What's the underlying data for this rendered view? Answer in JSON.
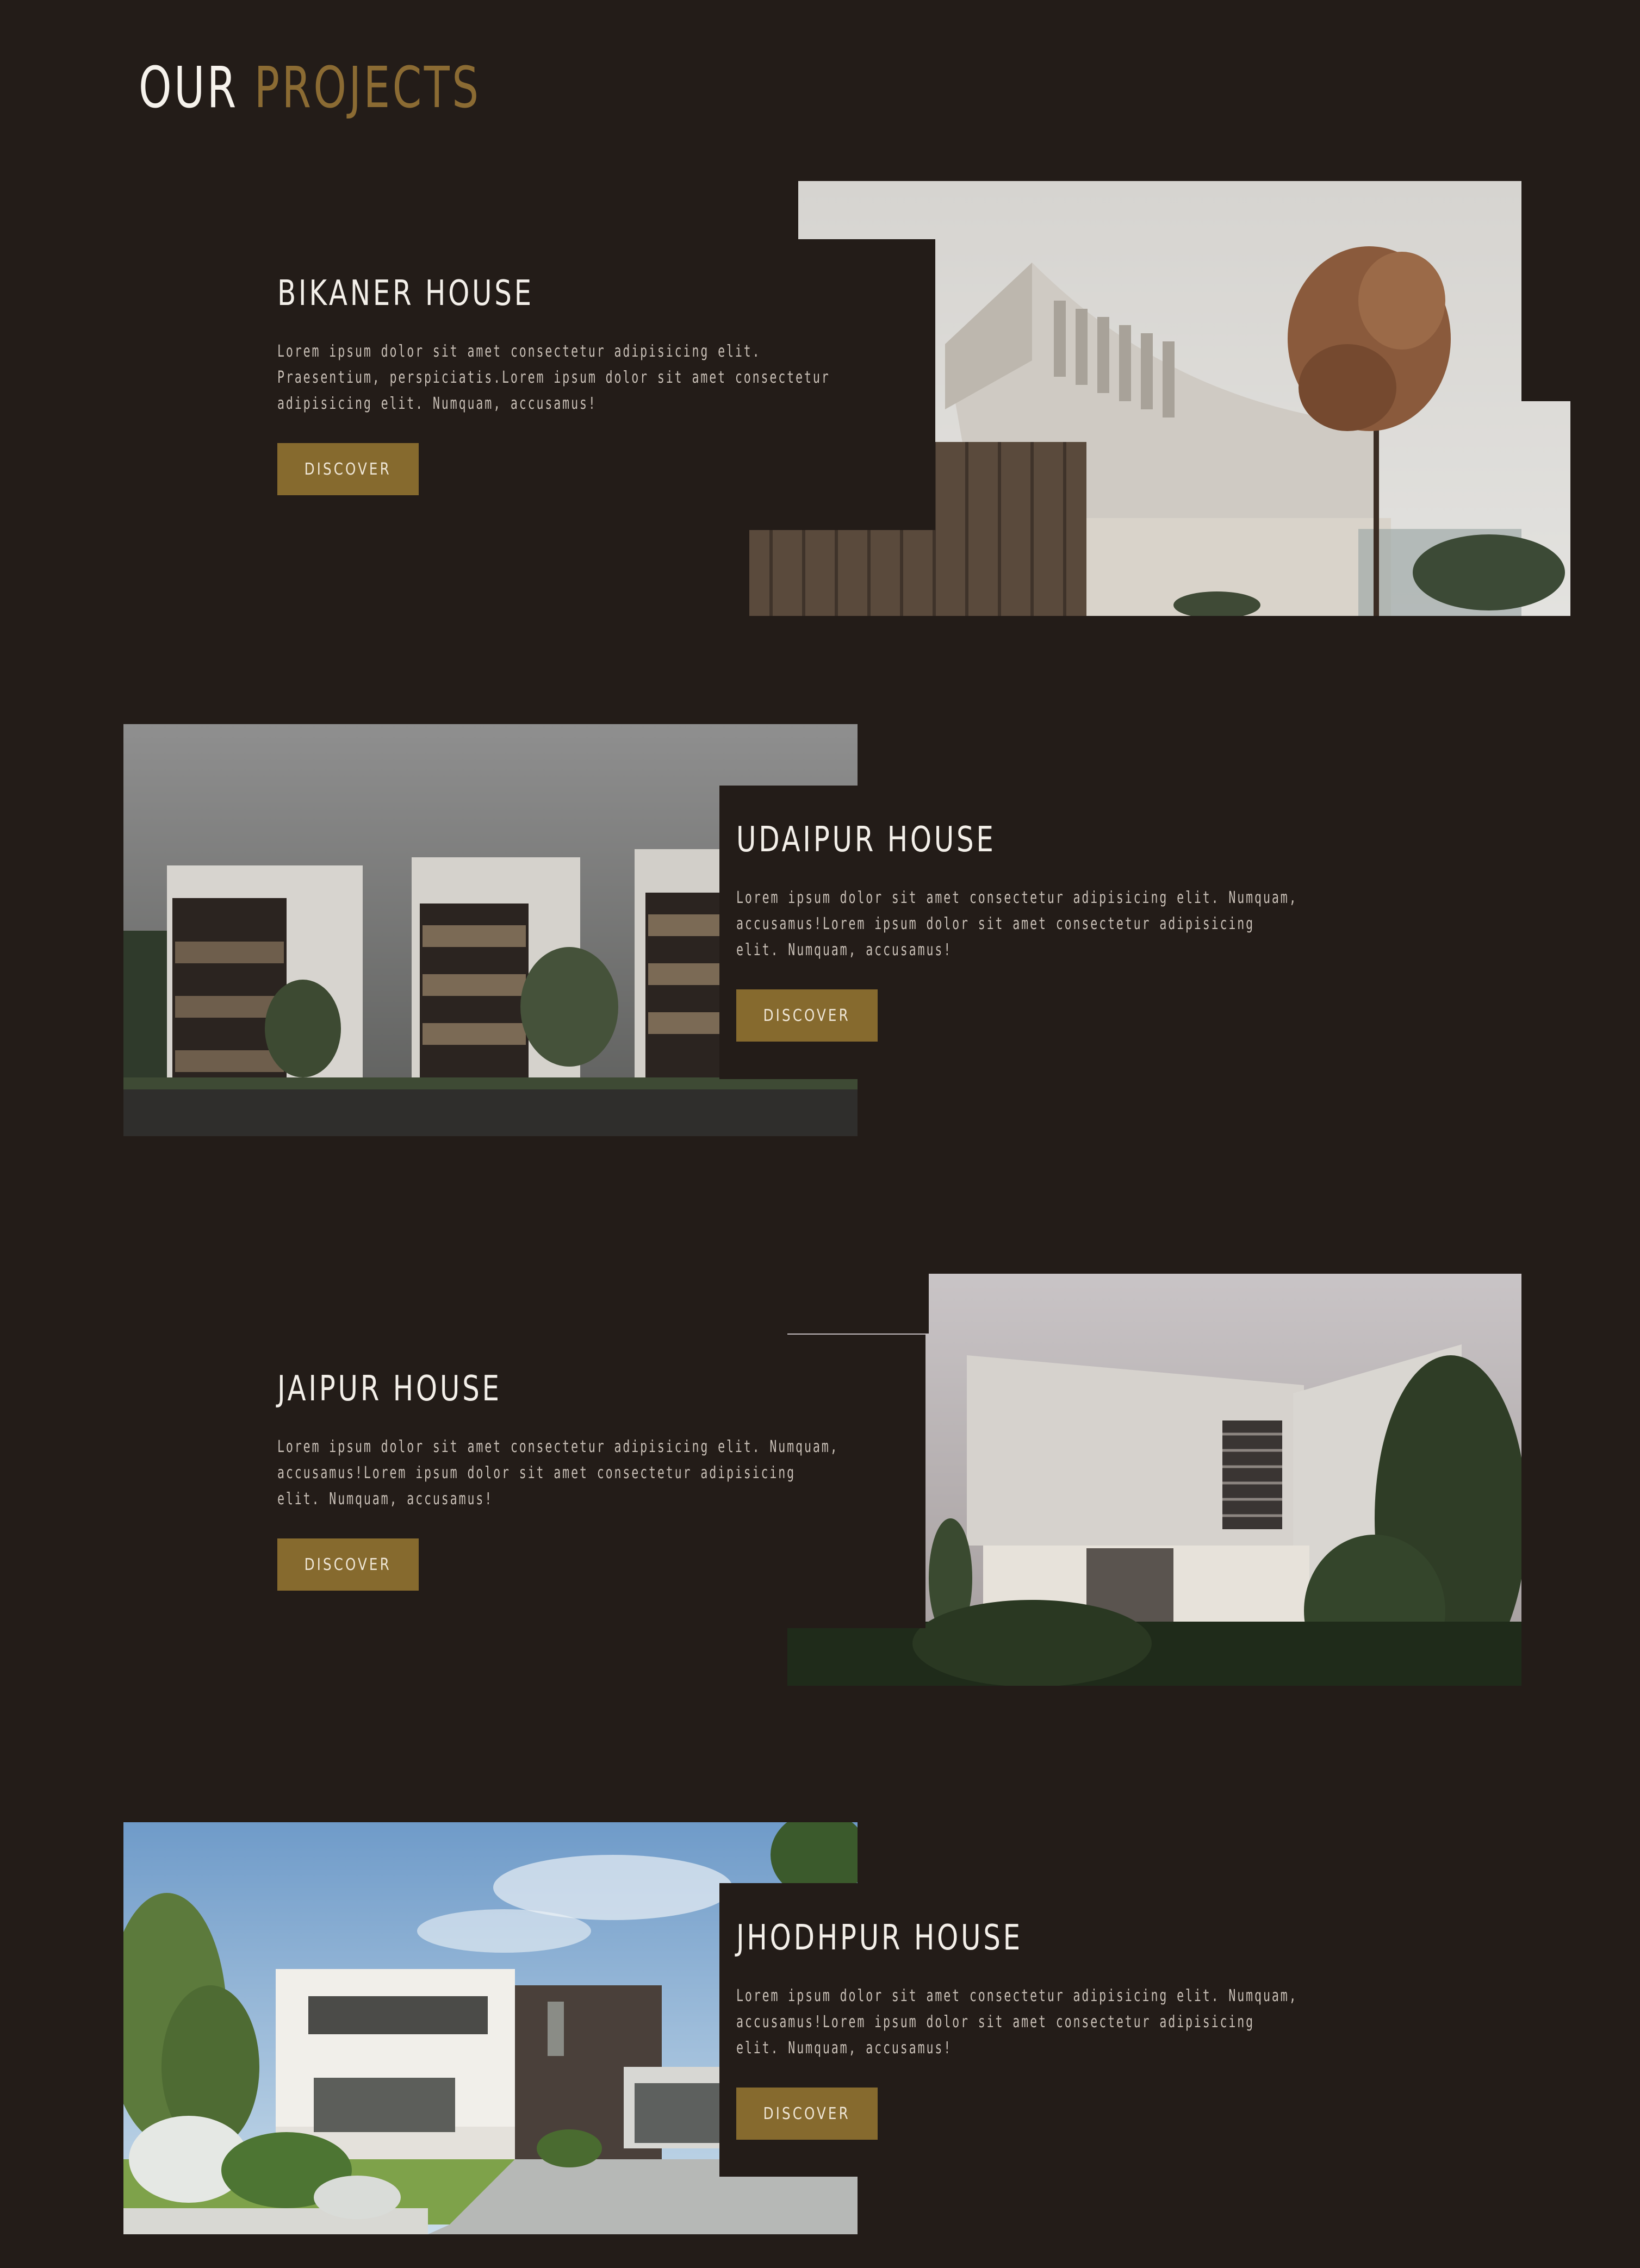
{
  "heading": {
    "word1": "OUR",
    "word2": "PROJECTS"
  },
  "colors": {
    "background": "#231c18",
    "accent_gold": "#866a2e",
    "heading_gold": "#8b6b33",
    "text_light": "#f3efe9",
    "text_muted": "#c8bfb6"
  },
  "projects": [
    {
      "title": "BIKANER HOUSE",
      "description": "Lorem ipsum dolor sit amet consectetur adipisicing elit. Praesentium, perspiciatis.Lorem ipsum dolor sit amet consectetur adipisicing elit. Numquam, accusamus!",
      "button": "DISCOVER",
      "image": "curved white brick house with tree"
    },
    {
      "title": "UDAIPUR HOUSE",
      "description": "Lorem ipsum dolor sit amet consectetur adipisicing elit. Numquam, accusamus!Lorem ipsum dolor sit amet consectetur adipisicing elit. Numquam, accusamus!",
      "button": "DISCOVER",
      "image": "white apartment blocks under grey sky"
    },
    {
      "title": "JAIPUR HOUSE",
      "description": "Lorem ipsum dolor sit amet consectetur adipisicing elit. Numquam, accusamus!Lorem ipsum dolor sit amet consectetur adipisicing elit. Numquam, accusamus!",
      "button": "DISCOVER",
      "image": "white cube house with trees"
    },
    {
      "title": "JHODHPUR HOUSE",
      "description": "Lorem ipsum dolor sit amet consectetur adipisicing elit. Numquam, accusamus!Lorem ipsum dolor sit amet consectetur adipisicing elit. Numquam, accusamus!",
      "button": "DISCOVER",
      "image": "modern white and dark wood villa under blue sky"
    }
  ]
}
